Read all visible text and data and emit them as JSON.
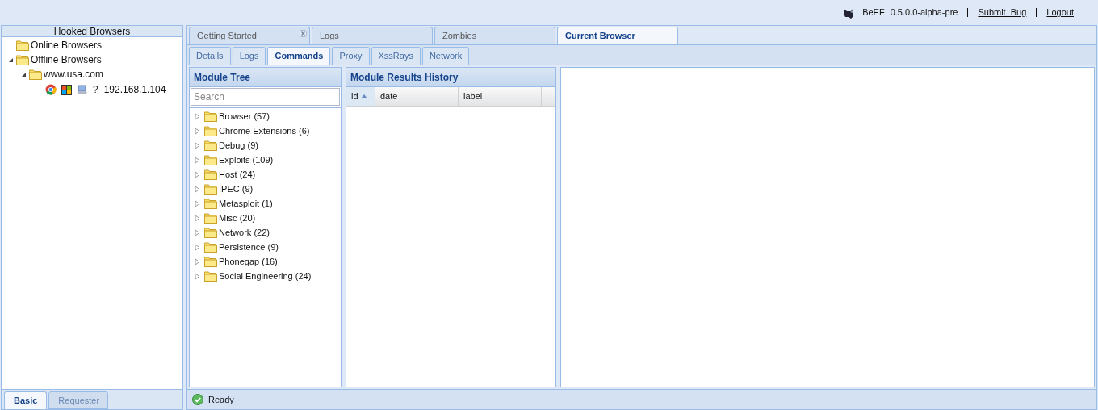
{
  "header": {
    "app_name": "BeEF",
    "version": "0.5.0.0-alpha-pre",
    "links": [
      {
        "label": "Submit  Bug"
      },
      {
        "label": "Logout"
      }
    ]
  },
  "hooked_browsers": {
    "title": "Hooked Browsers",
    "tree": [
      {
        "label": "Online Browsers"
      },
      {
        "label": "Offline Browsers",
        "expanded": true,
        "children": [
          {
            "label": "www.usa.com",
            "expanded": true,
            "children": [
              {
                "kind": "browser",
                "os_mark": "?",
                "label": "192.168.1.104"
              }
            ]
          }
        ]
      }
    ],
    "tabs": [
      {
        "label": "Basic",
        "selected": true
      },
      {
        "label": "Requester",
        "selected": false
      }
    ]
  },
  "main_tabs": [
    {
      "label": "Getting Started",
      "selected": false,
      "closable": true
    },
    {
      "label": "Logs",
      "selected": false,
      "closable": false
    },
    {
      "label": "Zombies",
      "selected": false,
      "closable": false
    },
    {
      "label": "Current Browser",
      "selected": true,
      "closable": false
    }
  ],
  "sub_tabs": [
    {
      "label": "Details",
      "selected": false
    },
    {
      "label": "Logs",
      "selected": false
    },
    {
      "label": "Commands",
      "selected": true
    },
    {
      "label": "Proxy",
      "selected": false
    },
    {
      "label": "XssRays",
      "selected": false
    },
    {
      "label": "Network",
      "selected": false
    }
  ],
  "module_tree": {
    "title": "Module Tree",
    "search": {
      "placeholder": "Search"
    },
    "items": [
      {
        "label": "Browser (57)",
        "expanded": false
      },
      {
        "label": "Chrome Extensions (6)",
        "expanded": false
      },
      {
        "label": "Debug (9)",
        "expanded": false
      },
      {
        "label": "Exploits (109)",
        "expanded": false
      },
      {
        "label": "Host (24)",
        "expanded": false
      },
      {
        "label": "IPEC (9)",
        "expanded": false
      },
      {
        "label": "Metasploit (1)",
        "expanded": false
      },
      {
        "label": "Misc (20)",
        "expanded": false
      },
      {
        "label": "Network (22)",
        "expanded": false
      },
      {
        "label": "Persistence (9)",
        "expanded": false
      },
      {
        "label": "Phonegap (16)",
        "expanded": false
      },
      {
        "label": "Social Engineering (24)",
        "expanded": false
      }
    ]
  },
  "results": {
    "title": "Module Results History",
    "columns": [
      {
        "label": "id",
        "sorted": true
      },
      {
        "label": "date",
        "sorted": false
      },
      {
        "label": "label",
        "sorted": false
      }
    ]
  },
  "status_bar": {
    "text": "Ready"
  }
}
